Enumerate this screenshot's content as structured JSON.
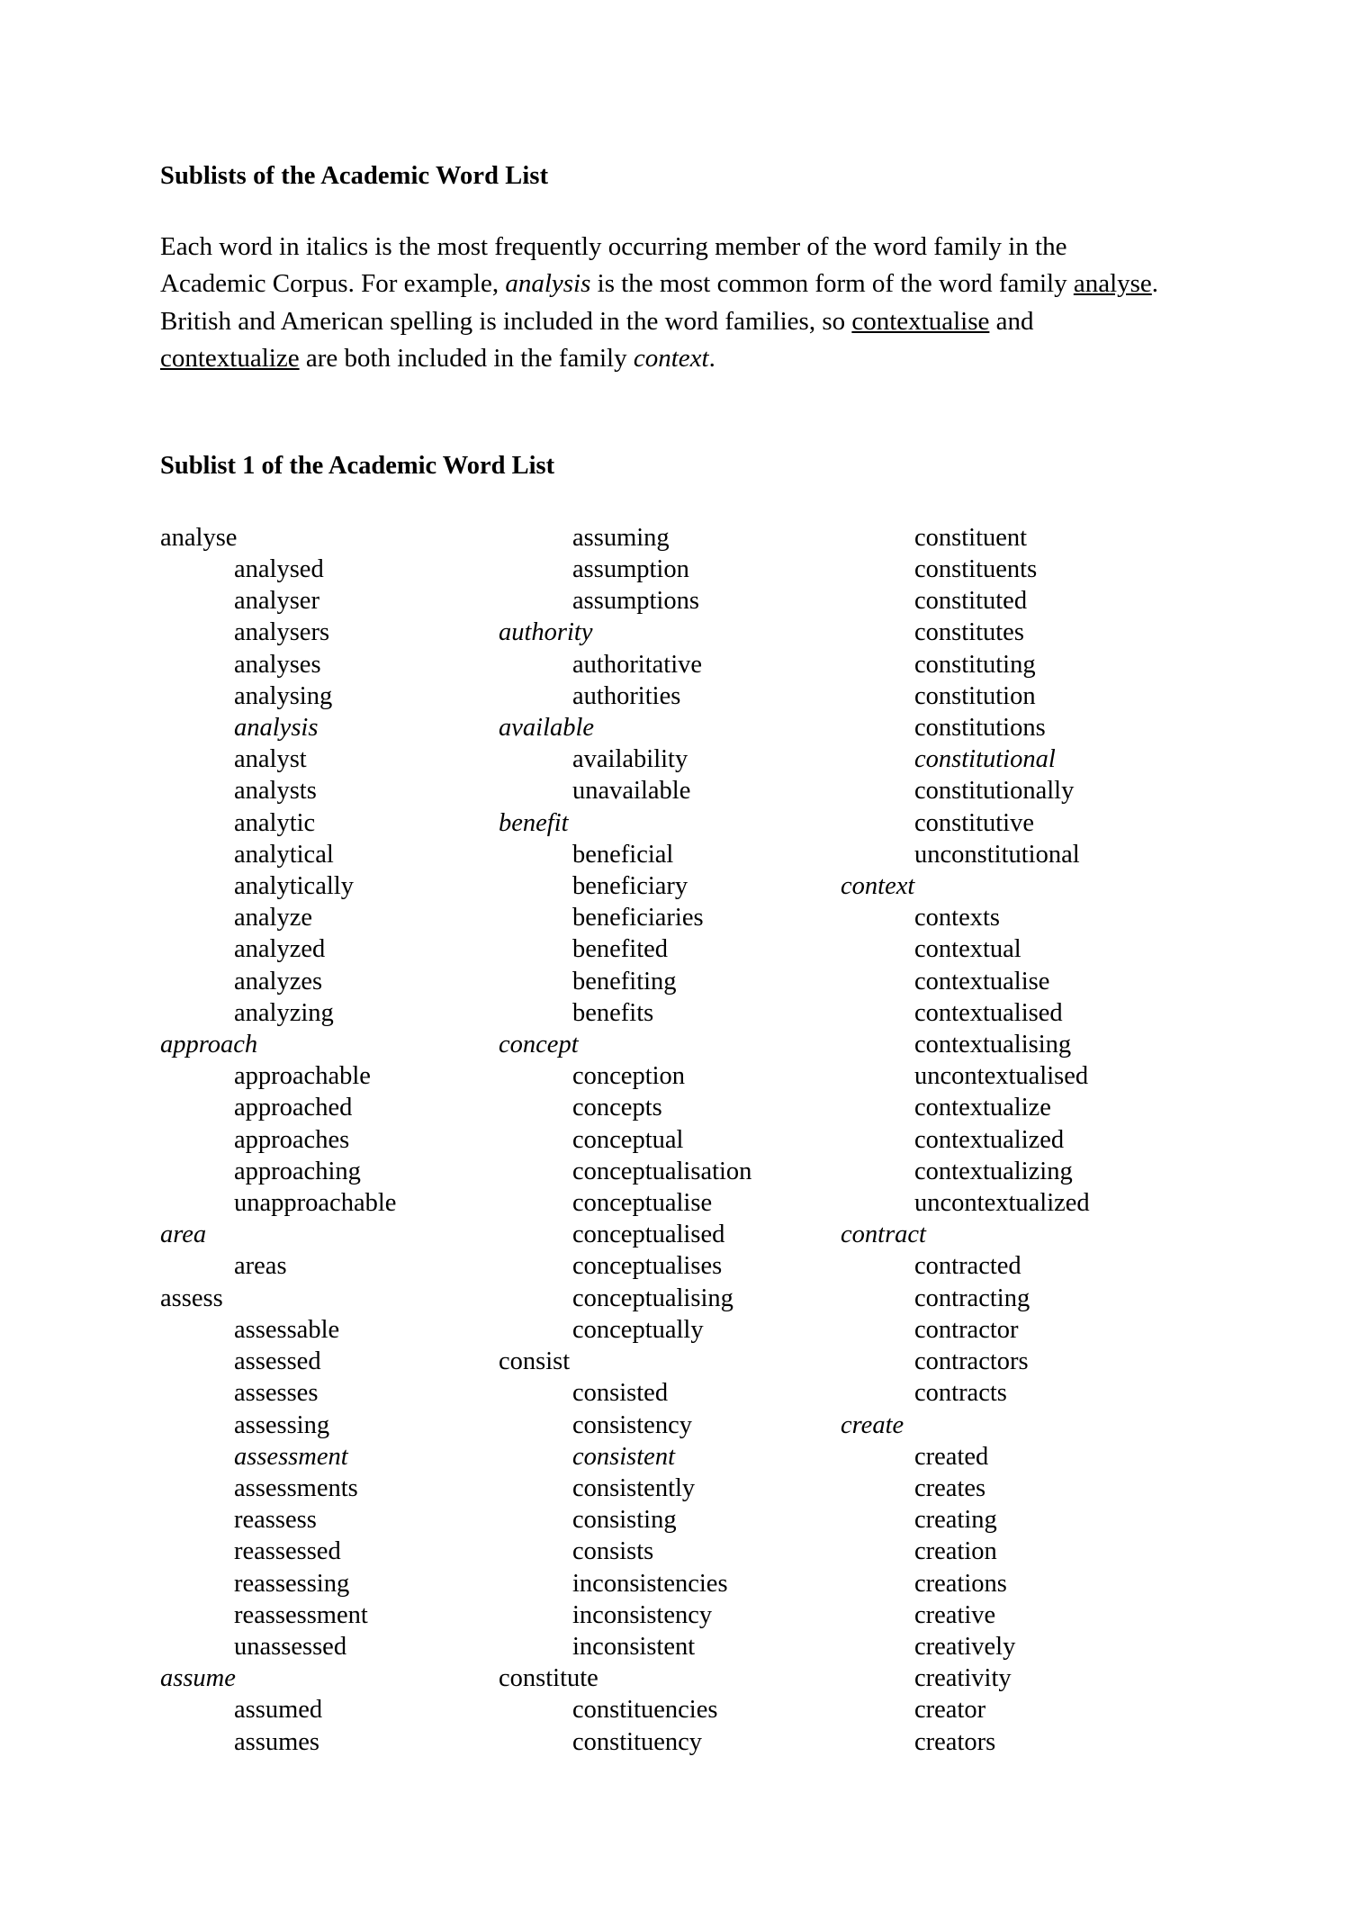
{
  "document": {
    "title": "Sublists of the Academic Word List",
    "intro": {
      "part1": "Each word in italics is the most frequently occurring member of the word family in the Academic Corpus.    For example, ",
      "italic1": "analysis",
      "part2": " is the most common form of the word family ",
      "underline1": "analyse",
      "part3": ".    British and American spelling is included in the word families, so ",
      "underline2": "contextualise",
      "part4": " and ",
      "underline3": "contextualize",
      "part5": " are both included in the family ",
      "italic2": "context",
      "part6": "."
    },
    "sublist_heading": "Sublist 1 of the Academic Word List"
  },
  "columns": [
    {
      "id": "column-1",
      "entries": [
        {
          "text": "analyse",
          "level": "head",
          "italic": false
        },
        {
          "text": "analysed",
          "level": "sub",
          "italic": false
        },
        {
          "text": "analyser",
          "level": "sub",
          "italic": false
        },
        {
          "text": "analysers",
          "level": "sub",
          "italic": false
        },
        {
          "text": "analyses",
          "level": "sub",
          "italic": false
        },
        {
          "text": "analysing",
          "level": "sub",
          "italic": false
        },
        {
          "text": "analysis",
          "level": "sub",
          "italic": true
        },
        {
          "text": "analyst",
          "level": "sub",
          "italic": false
        },
        {
          "text": "analysts",
          "level": "sub",
          "italic": false
        },
        {
          "text": "analytic",
          "level": "sub",
          "italic": false
        },
        {
          "text": "analytical",
          "level": "sub",
          "italic": false
        },
        {
          "text": "analytically",
          "level": "sub",
          "italic": false
        },
        {
          "text": "analyze",
          "level": "sub",
          "italic": false
        },
        {
          "text": "analyzed",
          "level": "sub",
          "italic": false
        },
        {
          "text": "analyzes",
          "level": "sub",
          "italic": false
        },
        {
          "text": "analyzing",
          "level": "sub",
          "italic": false
        },
        {
          "text": "approach",
          "level": "head",
          "italic": true
        },
        {
          "text": "approachable",
          "level": "sub",
          "italic": false
        },
        {
          "text": "approached",
          "level": "sub",
          "italic": false
        },
        {
          "text": "approaches",
          "level": "sub",
          "italic": false
        },
        {
          "text": "approaching",
          "level": "sub",
          "italic": false
        },
        {
          "text": "unapproachable",
          "level": "sub",
          "italic": false
        },
        {
          "text": "area",
          "level": "head",
          "italic": true
        },
        {
          "text": "areas",
          "level": "sub",
          "italic": false
        },
        {
          "text": "assess",
          "level": "head",
          "italic": false
        },
        {
          "text": "assessable",
          "level": "sub",
          "italic": false
        },
        {
          "text": "assessed",
          "level": "sub",
          "italic": false
        },
        {
          "text": "assesses",
          "level": "sub",
          "italic": false
        },
        {
          "text": "assessing",
          "level": "sub",
          "italic": false
        },
        {
          "text": "assessment",
          "level": "sub",
          "italic": true
        },
        {
          "text": "assessments",
          "level": "sub",
          "italic": false
        },
        {
          "text": "reassess",
          "level": "sub",
          "italic": false
        },
        {
          "text": "reassessed",
          "level": "sub",
          "italic": false
        },
        {
          "text": "reassessing",
          "level": "sub",
          "italic": false
        },
        {
          "text": "reassessment",
          "level": "sub",
          "italic": false
        },
        {
          "text": "unassessed",
          "level": "sub",
          "italic": false
        },
        {
          "text": "assume",
          "level": "head",
          "italic": true
        },
        {
          "text": "assumed",
          "level": "sub",
          "italic": false
        },
        {
          "text": "assumes",
          "level": "sub",
          "italic": false
        }
      ]
    },
    {
      "id": "column-2",
      "entries": [
        {
          "text": "assuming",
          "level": "sub",
          "italic": false
        },
        {
          "text": "assumption",
          "level": "sub",
          "italic": false
        },
        {
          "text": "assumptions",
          "level": "sub",
          "italic": false
        },
        {
          "text": "authority",
          "level": "head",
          "italic": true
        },
        {
          "text": "authoritative",
          "level": "sub",
          "italic": false
        },
        {
          "text": "authorities",
          "level": "sub",
          "italic": false
        },
        {
          "text": "available",
          "level": "head",
          "italic": true
        },
        {
          "text": "availability",
          "level": "sub",
          "italic": false
        },
        {
          "text": "unavailable",
          "level": "sub",
          "italic": false
        },
        {
          "text": "benefit",
          "level": "head",
          "italic": true
        },
        {
          "text": "beneficial",
          "level": "sub",
          "italic": false
        },
        {
          "text": "beneficiary",
          "level": "sub",
          "italic": false
        },
        {
          "text": "beneficiaries",
          "level": "sub",
          "italic": false
        },
        {
          "text": "benefited",
          "level": "sub",
          "italic": false
        },
        {
          "text": "benefiting",
          "level": "sub",
          "italic": false
        },
        {
          "text": "benefits",
          "level": "sub",
          "italic": false
        },
        {
          "text": "concept",
          "level": "head",
          "italic": true
        },
        {
          "text": "conception",
          "level": "sub",
          "italic": false
        },
        {
          "text": "concepts",
          "level": "sub",
          "italic": false
        },
        {
          "text": "conceptual",
          "level": "sub",
          "italic": false
        },
        {
          "text": "conceptualisation",
          "level": "sub",
          "italic": false
        },
        {
          "text": "conceptualise",
          "level": "sub",
          "italic": false
        },
        {
          "text": "conceptualised",
          "level": "sub",
          "italic": false
        },
        {
          "text": "conceptualises",
          "level": "sub",
          "italic": false
        },
        {
          "text": "conceptualising",
          "level": "sub",
          "italic": false
        },
        {
          "text": "conceptually",
          "level": "sub",
          "italic": false
        },
        {
          "text": "consist",
          "level": "head",
          "italic": false
        },
        {
          "text": "consisted",
          "level": "sub",
          "italic": false
        },
        {
          "text": "consistency",
          "level": "sub",
          "italic": false
        },
        {
          "text": "consistent",
          "level": "sub",
          "italic": true
        },
        {
          "text": "consistently",
          "level": "sub",
          "italic": false
        },
        {
          "text": "consisting",
          "level": "sub",
          "italic": false
        },
        {
          "text": "consists",
          "level": "sub",
          "italic": false
        },
        {
          "text": "inconsistencies",
          "level": "sub",
          "italic": false
        },
        {
          "text": "inconsistency",
          "level": "sub",
          "italic": false
        },
        {
          "text": "inconsistent",
          "level": "sub",
          "italic": false
        },
        {
          "text": "constitute",
          "level": "head",
          "italic": false
        },
        {
          "text": "constituencies",
          "level": "sub",
          "italic": false
        },
        {
          "text": "constituency",
          "level": "sub",
          "italic": false
        }
      ]
    },
    {
      "id": "column-3",
      "entries": [
        {
          "text": "constituent",
          "level": "sub",
          "italic": false
        },
        {
          "text": "constituents",
          "level": "sub",
          "italic": false
        },
        {
          "text": "constituted",
          "level": "sub",
          "italic": false
        },
        {
          "text": "constitutes",
          "level": "sub",
          "italic": false
        },
        {
          "text": "constituting",
          "level": "sub",
          "italic": false
        },
        {
          "text": "constitution",
          "level": "sub",
          "italic": false
        },
        {
          "text": "constitutions",
          "level": "sub",
          "italic": false
        },
        {
          "text": "constitutional",
          "level": "sub",
          "italic": true
        },
        {
          "text": "constitutionally",
          "level": "sub",
          "italic": false
        },
        {
          "text": "constitutive",
          "level": "sub",
          "italic": false
        },
        {
          "text": "unconstitutional",
          "level": "sub",
          "italic": false
        },
        {
          "text": "context",
          "level": "head",
          "italic": true
        },
        {
          "text": "contexts",
          "level": "sub",
          "italic": false
        },
        {
          "text": "contextual",
          "level": "sub",
          "italic": false
        },
        {
          "text": "contextualise",
          "level": "sub",
          "italic": false
        },
        {
          "text": "contextualised",
          "level": "sub",
          "italic": false
        },
        {
          "text": "contextualising",
          "level": "sub",
          "italic": false
        },
        {
          "text": "uncontextualised",
          "level": "sub",
          "italic": false
        },
        {
          "text": "contextualize",
          "level": "sub",
          "italic": false
        },
        {
          "text": "contextualized",
          "level": "sub",
          "italic": false
        },
        {
          "text": "contextualizing",
          "level": "sub",
          "italic": false
        },
        {
          "text": "uncontextualized",
          "level": "sub",
          "italic": false
        },
        {
          "text": "contract",
          "level": "head",
          "italic": true
        },
        {
          "text": "contracted",
          "level": "sub",
          "italic": false
        },
        {
          "text": "contracting",
          "level": "sub",
          "italic": false
        },
        {
          "text": "contractor",
          "level": "sub",
          "italic": false
        },
        {
          "text": "contractors",
          "level": "sub",
          "italic": false
        },
        {
          "text": "contracts",
          "level": "sub",
          "italic": false
        },
        {
          "text": "create",
          "level": "head",
          "italic": true
        },
        {
          "text": "created",
          "level": "sub",
          "italic": false
        },
        {
          "text": "creates",
          "level": "sub",
          "italic": false
        },
        {
          "text": "creating",
          "level": "sub",
          "italic": false
        },
        {
          "text": "creation",
          "level": "sub",
          "italic": false
        },
        {
          "text": "creations",
          "level": "sub",
          "italic": false
        },
        {
          "text": "creative",
          "level": "sub",
          "italic": false
        },
        {
          "text": "creatively",
          "level": "sub",
          "italic": false
        },
        {
          "text": "creativity",
          "level": "sub",
          "italic": false
        },
        {
          "text": "creator",
          "level": "sub",
          "italic": false
        },
        {
          "text": "creators",
          "level": "sub",
          "italic": false
        }
      ]
    }
  ]
}
